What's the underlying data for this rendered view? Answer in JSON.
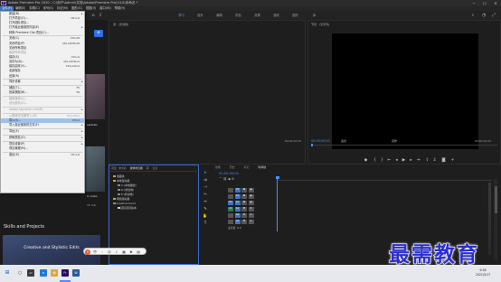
{
  "window": {
    "title": "Adobe Premiere Pro 2020 - C:\\用户\\Admin\\文档\\Adobe\\Premiere Pro\\14.0\\未命名 *",
    "app_badge": "Pr"
  },
  "menubar": {
    "items": [
      "文件(F)",
      "编辑(E)",
      "剪辑(C)",
      "序列(S)",
      "标记(M)",
      "图形(G)",
      "视图(V)",
      "窗口(W)",
      "帮助(H)"
    ]
  },
  "workspace": {
    "tabs": [
      "学习",
      "组件",
      "编辑",
      "颜色",
      "效果",
      "音频",
      "图形",
      "库"
    ],
    "active": "学习"
  },
  "file_menu": {
    "items": [
      {
        "label": "新建(N)",
        "shortcut": "",
        "arrow": true,
        "disabled": false,
        "highlighted": false
      },
      {
        "label": "打开项目(O)...",
        "shortcut": "Ctrl+O",
        "arrow": false,
        "disabled": false,
        "highlighted": false
      },
      {
        "label": "打开团队项目...",
        "shortcut": "",
        "arrow": false,
        "disabled": false,
        "highlighted": false
      },
      {
        "label": "打开最近使用的内容(E)",
        "shortcut": "",
        "arrow": true,
        "disabled": false,
        "highlighted": false
      },
      {
        "label": "转换 Premiere Clip 项目(C)...",
        "shortcut": "",
        "arrow": false,
        "disabled": false,
        "highlighted": false,
        "sep_after": true
      },
      {
        "label": "关闭(C)",
        "shortcut": "Ctrl+W",
        "arrow": false,
        "disabled": false,
        "highlighted": false
      },
      {
        "label": "关闭项目(P)",
        "shortcut": "Ctrl+Shift+W",
        "arrow": false,
        "disabled": false,
        "highlighted": false
      },
      {
        "label": "关闭所有项目",
        "shortcut": "",
        "arrow": false,
        "disabled": false,
        "highlighted": false
      },
      {
        "label": "刷新所有项目",
        "shortcut": "",
        "arrow": false,
        "disabled": true,
        "highlighted": false
      },
      {
        "label": "保存(S)",
        "shortcut": "Ctrl+S",
        "arrow": false,
        "disabled": false,
        "highlighted": false
      },
      {
        "label": "另存为(A)...",
        "shortcut": "Ctrl+Shift+S",
        "arrow": false,
        "disabled": false,
        "highlighted": false
      },
      {
        "label": "保存副本(Y)...",
        "shortcut": "Ctrl+Alt+S",
        "arrow": false,
        "disabled": false,
        "highlighted": false
      },
      {
        "label": "全部保存",
        "shortcut": "",
        "arrow": false,
        "disabled": false,
        "highlighted": false
      },
      {
        "label": "还原(R)",
        "shortcut": "",
        "arrow": false,
        "disabled": false,
        "highlighted": false,
        "sep_after": true
      },
      {
        "label": "同步设置",
        "shortcut": "",
        "arrow": true,
        "disabled": false,
        "highlighted": false,
        "sep_after": true
      },
      {
        "label": "捕捉(T)...",
        "shortcut": "F5",
        "arrow": false,
        "disabled": false,
        "highlighted": false
      },
      {
        "label": "批量捕捉(B)...",
        "shortcut": "F6",
        "arrow": false,
        "disabled": false,
        "highlighted": false,
        "sep_after": true
      },
      {
        "label": "链接媒体(L)...",
        "shortcut": "",
        "arrow": false,
        "disabled": true,
        "highlighted": false
      },
      {
        "label": "设为脱机(O)...",
        "shortcut": "",
        "arrow": false,
        "disabled": true,
        "highlighted": false,
        "sep_after": true
      },
      {
        "label": "Adobe Dynamic Link(K)",
        "shortcut": "",
        "arrow": true,
        "disabled": true,
        "highlighted": false,
        "sep_after": true
      },
      {
        "label": "从媒体浏览器导入(M)",
        "shortcut": "Ctrl+Alt+I",
        "arrow": false,
        "disabled": true,
        "highlighted": false
      },
      {
        "label": "导入(I)...",
        "shortcut": "Ctrl+I",
        "arrow": false,
        "disabled": false,
        "highlighted": true
      },
      {
        "label": "导入最近使用的文件(F)",
        "shortcut": "",
        "arrow": true,
        "disabled": false,
        "highlighted": false,
        "sep_after": true
      },
      {
        "label": "导出(E)",
        "shortcut": "",
        "arrow": true,
        "disabled": false,
        "highlighted": false,
        "sep_after": true
      },
      {
        "label": "获取属性(G)",
        "shortcut": "",
        "arrow": true,
        "disabled": false,
        "highlighted": false,
        "sep_after": true
      },
      {
        "label": "项目设置(P)",
        "shortcut": "",
        "arrow": true,
        "disabled": false,
        "highlighted": false
      },
      {
        "label": "项目管理(M)...",
        "shortcut": "",
        "arrow": false,
        "disabled": false,
        "highlighted": false,
        "sep_after": true
      },
      {
        "label": "退出(X)",
        "shortcut": "Ctrl+Q",
        "arrow": false,
        "disabled": false,
        "highlighted": false
      }
    ]
  },
  "learn_panel": {
    "skills_title": "Skills and Projects",
    "card_title": "Creative and Stylistic Edits",
    "card_desc": "Five interactive tutorials that teach the basics of adding clip speed, adding titles and transitions, adjusting audio, and color correction.",
    "side_labels": [
      "sentials",
      "ic video",
      "15 min"
    ]
  },
  "source_monitor": {
    "tab": "源：(无剪辑)",
    "timecode": "00;00;00;00"
  },
  "program_monitor": {
    "tab": "节目：(无序列)",
    "timecode": "00;00;00;00",
    "fit": "适合",
    "ratio": "完整",
    "duration": "00;00;00;00"
  },
  "project_panel": {
    "tabs": [
      "项目：未命名",
      "媒体浏览器",
      "库",
      "信息"
    ],
    "tree": [
      {
        "label": "收藏夹",
        "icon": "folder",
        "indent": 0
      },
      {
        "label": "本地驱动器",
        "icon": "folder",
        "indent": 0
      },
      {
        "label": "C:(本地磁盘)",
        "icon": "drive",
        "indent": 1
      },
      {
        "label": "D:(新加卷)",
        "icon": "drive",
        "indent": 1
      },
      {
        "label": "E:(新加卷)",
        "icon": "drive",
        "indent": 1
      },
      {
        "label": "网络驱动器",
        "icon": "folder",
        "indent": 0
      },
      {
        "label": "Creative Cloud",
        "icon": "cloud",
        "indent": 0
      },
      {
        "label": "团队项目版本",
        "icon": "team",
        "indent": 1
      }
    ]
  },
  "timeline_panel": {
    "tabs": [
      "效果",
      "历史",
      "标记",
      "时间线"
    ],
    "active_tab": "时间线",
    "timecode": "00;00;00;00",
    "video_tracks": [
      "V3",
      "V2",
      "V1"
    ],
    "audio_tracks": [
      "A1",
      "A2",
      "A3"
    ],
    "master": "主声道",
    "master_value": "0.0"
  },
  "taskbar": {
    "time": "9:28",
    "date": "2021/5/17"
  },
  "watermark": "最需教育",
  "colors": {
    "accent": "#4d8bff",
    "menu_highlight": "#9ec1ea",
    "watermark": "#2a2fd0"
  }
}
